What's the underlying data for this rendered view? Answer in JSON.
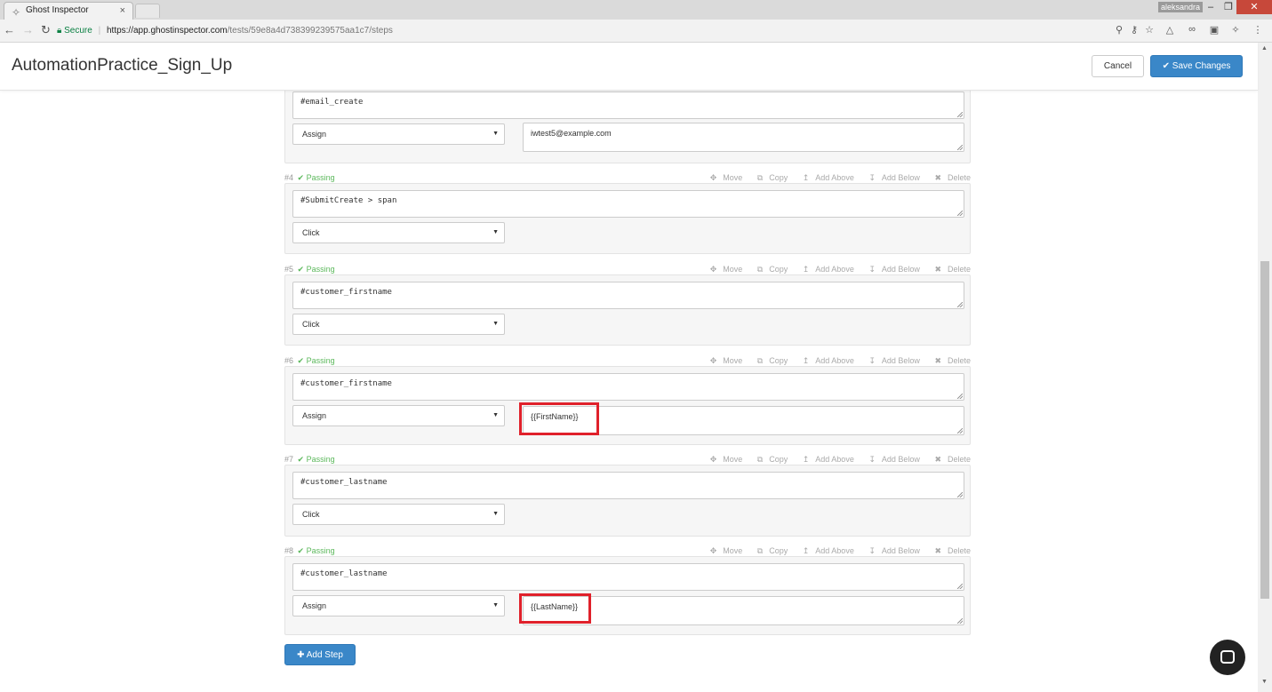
{
  "browser": {
    "tab_title": "Ghost Inspector",
    "tab_close": "×",
    "profile": "aleksandra",
    "win_min": "–",
    "win_restore": "❐",
    "win_close": "✕",
    "secure_label": "Secure",
    "url_host": "https://app.ghostinspector.com",
    "url_path": "/tests/59e8a4d738399239575aa1c7/steps"
  },
  "header": {
    "title": "AutomationPractice_Sign_Up",
    "cancel_label": "Cancel",
    "save_label": "Save Changes"
  },
  "step_actions": {
    "move": "Move",
    "copy": "Copy",
    "add_above": "Add Above",
    "add_below": "Add Below",
    "delete": "Delete"
  },
  "steps": [
    {
      "target": "#email_create",
      "command": "Assign",
      "value": "iwtest5@example.com"
    },
    {
      "num": "#4",
      "status": "Passing",
      "target": "#SubmitCreate > span",
      "command": "Click"
    },
    {
      "num": "#5",
      "status": "Passing",
      "target": "#customer_firstname",
      "command": "Click"
    },
    {
      "num": "#6",
      "status": "Passing",
      "target": "#customer_firstname",
      "command": "Assign",
      "value": "{{FirstName}}"
    },
    {
      "num": "#7",
      "status": "Passing",
      "target": "#customer_lastname",
      "command": "Click"
    },
    {
      "num": "#8",
      "status": "Passing",
      "target": "#customer_lastname",
      "command": "Assign",
      "value": "{{LastName}}"
    }
  ],
  "add_step_label": "Add Step",
  "colors": {
    "primary": "#3a87c8",
    "passing": "#5cb85c",
    "highlight": "#e0212b"
  }
}
